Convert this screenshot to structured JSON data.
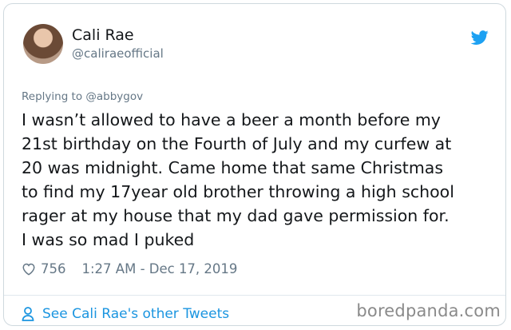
{
  "tweet": {
    "author_name": "Cali Rae",
    "author_handle": "@caliraeofficial",
    "replying_to": "Replying to @abbygov",
    "text_lines": [
      "I wasn’t allowed to have a beer a month before my",
      "21st birthday on the Fourth of July and my curfew at",
      "20 was midnight. Came home that same Christmas",
      "to find my 17year old brother throwing a high school",
      "rager at my house that my dad gave permission for.",
      "I was so mad I puked"
    ],
    "like_count": "756",
    "timestamp": "1:27 AM - Dec 17, 2019",
    "icons": {
      "brand": "twitter-bird-icon",
      "like": "heart-icon",
      "profile": "person-icon"
    }
  },
  "footer": {
    "other_tweets_link": "See Cali Rae's other Tweets",
    "watermark": "boredpanda.com"
  },
  "colors": {
    "accent": "#1da1f2",
    "link": "#1b95e0",
    "text": "#14171a",
    "muted": "#657786"
  }
}
